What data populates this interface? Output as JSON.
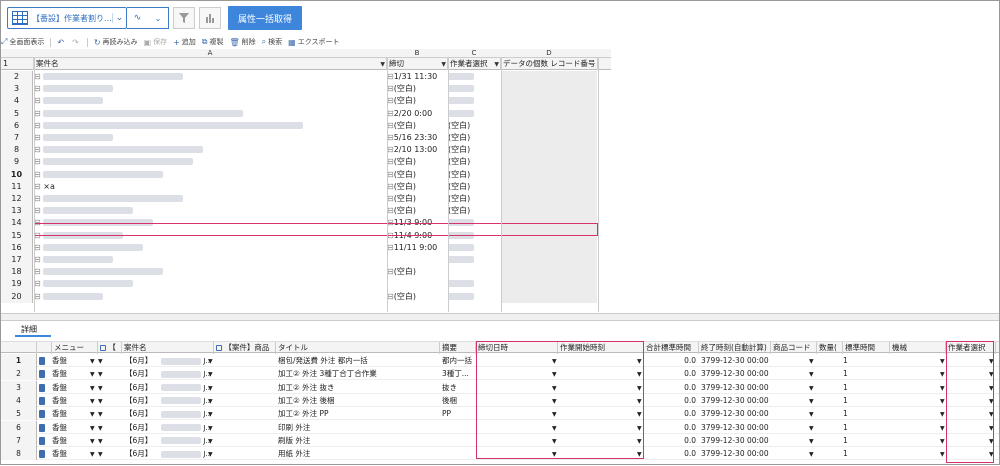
{
  "toolbar": {
    "view_name": "【番設】作業者割り...",
    "bulk_button": "属性一括取得"
  },
  "command_bar": [
    {
      "icon": "expand-icon",
      "label": "全画面表示",
      "disabled": false
    },
    {
      "icon": "undo-icon",
      "label": "",
      "disabled": false
    },
    {
      "icon": "redo-icon",
      "label": "",
      "disabled": true
    },
    {
      "icon": "reload-icon",
      "label": "再読み込み",
      "disabled": false
    },
    {
      "icon": "save-icon",
      "label": "保存",
      "disabled": true
    },
    {
      "icon": "add-icon",
      "label": "追加",
      "disabled": false
    },
    {
      "icon": "copy-icon",
      "label": "複製",
      "disabled": false
    },
    {
      "icon": "delete-icon",
      "label": "削除",
      "disabled": false
    },
    {
      "icon": "search-icon",
      "label": "検索",
      "disabled": false
    },
    {
      "icon": "export-icon",
      "label": "エクスポート",
      "disabled": false
    }
  ],
  "upper_grid": {
    "column_letters": [
      "A",
      "B",
      "C",
      "D"
    ],
    "headers": [
      "案件名",
      "締切",
      "作業者選択",
      "データの個数 レコード番号"
    ],
    "rows": [
      {
        "num": "2",
        "b": "1/31 11:30",
        "c": ""
      },
      {
        "num": "3",
        "b": "(空白)",
        "c": ""
      },
      {
        "num": "4",
        "b": "(空白)",
        "c": ""
      },
      {
        "num": "5",
        "b": "2/20 0:00",
        "c": ""
      },
      {
        "num": "6",
        "b": "(空白)",
        "c": "(空白)"
      },
      {
        "num": "7",
        "b": "5/16 23:30",
        "c": "(空白)"
      },
      {
        "num": "8",
        "b": "2/10 13:00",
        "c": "(空白)"
      },
      {
        "num": "9",
        "b": "(空白)",
        "c": "(空白)"
      },
      {
        "num": "10",
        "b": "(空白)",
        "c": "(空白)"
      },
      {
        "num": "11",
        "a": "×a",
        "b": "(空白)",
        "c": "(空白)"
      },
      {
        "num": "12",
        "b": "(空白)",
        "c": "(空白)"
      },
      {
        "num": "13",
        "b": "(空白)",
        "c": "(空白)"
      },
      {
        "num": "14",
        "b": "11/3 9:00",
        "c": ""
      },
      {
        "num": "15",
        "b": "11/4 9:00",
        "c": ""
      },
      {
        "num": "16",
        "b": "11/11 9:00",
        "c": ""
      },
      {
        "num": "17",
        "b": "",
        "c": ""
      },
      {
        "num": "18",
        "b": "(空白)",
        "c": ""
      },
      {
        "num": "19",
        "b": "",
        "c": ""
      },
      {
        "num": "20",
        "b": "(空白)",
        "c": ""
      }
    ]
  },
  "detail_tab": "詳細",
  "lower_grid": {
    "headers": [
      "メニュー",
      "【",
      "案件名",
      "【案件】商品",
      "タイトル",
      "摘要",
      "締切日時",
      "作業開始時刻",
      "合計標準時間",
      "終了時刻(自動計算)",
      "商品コード",
      "数量(",
      "標準時間",
      "機械",
      "作業者選択"
    ],
    "rows": [
      {
        "num": "1",
        "menu": "香盤",
        "case": "【6月】",
        "title": "梱包/発送費 外注 都内一括",
        "summary": "都内一括",
        "total": "0.0",
        "end": "3799-12-30 00:00",
        "qty": "1"
      },
      {
        "num": "2",
        "menu": "香盤",
        "case": "【6月】",
        "title": "加工② 外注 3種丁合丁合作業",
        "summary": "3種丁...",
        "total": "0.0",
        "end": "3799-12-30 00:00",
        "qty": "1"
      },
      {
        "num": "3",
        "menu": "香盤",
        "case": "【6月】",
        "title": "加工② 外注 抜き",
        "summary": "抜き",
        "total": "0.0",
        "end": "3799-12-30 00:00",
        "qty": "1"
      },
      {
        "num": "4",
        "menu": "香盤",
        "case": "【6月】",
        "title": "加工② 外注 後梱",
        "summary": "後梱",
        "total": "0.0",
        "end": "3799-12-30 00:00",
        "qty": "1"
      },
      {
        "num": "5",
        "menu": "香盤",
        "case": "【6月】",
        "title": "加工② 外注 PP",
        "summary": "PP",
        "total": "0.0",
        "end": "3799-12-30 00:00",
        "qty": "1"
      },
      {
        "num": "6",
        "menu": "香盤",
        "case": "【6月】",
        "title": "印刷 外注",
        "summary": "",
        "total": "0.0",
        "end": "3799-12-30 00:00",
        "qty": "1"
      },
      {
        "num": "7",
        "menu": "香盤",
        "case": "【6月】",
        "title": "刷版 外注",
        "summary": "",
        "total": "0.0",
        "end": "3799-12-30 00:00",
        "qty": "1"
      },
      {
        "num": "8",
        "menu": "香盤",
        "case": "【6月】",
        "title": "用紙 外注",
        "summary": "",
        "total": "0.0",
        "end": "3799-12-30 00:00",
        "qty": "1"
      }
    ]
  },
  "colors": {
    "accent": "#3e86dc",
    "highlight": "#d6336c"
  }
}
